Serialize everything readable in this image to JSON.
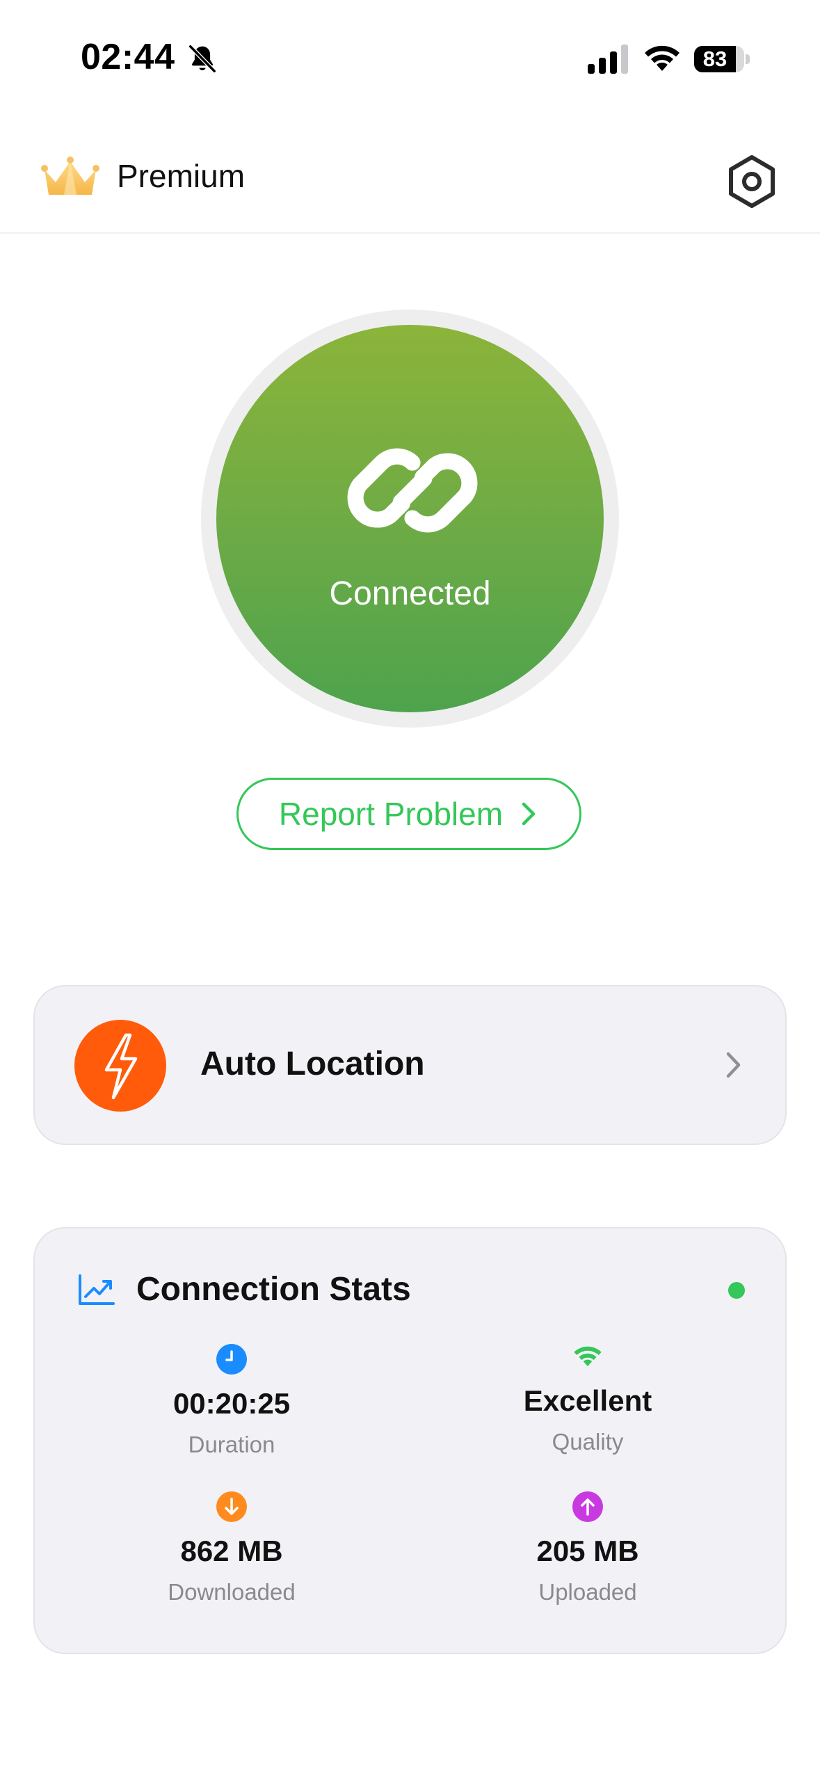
{
  "status_bar": {
    "time": "02:44",
    "battery": "83",
    "battery_level": 0.83,
    "icons": [
      "bell-slash-icon",
      "cellular-signal-icon",
      "wifi-icon",
      "battery-icon"
    ]
  },
  "header": {
    "title": "Premium",
    "icons": [
      "crown-icon",
      "settings-gear-icon"
    ]
  },
  "connection": {
    "status": "Connected",
    "icon": "link-icon",
    "report_label": "Report Problem"
  },
  "location": {
    "label": "Auto Location",
    "icon": "lightning-bolt-icon"
  },
  "stats": {
    "title": "Connection Stats",
    "items": [
      {
        "value": "00:20:25",
        "label": "Duration",
        "icon": "clock-icon",
        "color": "#1a8cff"
      },
      {
        "value": "Excellent",
        "label": "Quality",
        "icon": "wifi-quality-icon",
        "color": "#34c759"
      },
      {
        "value": "862 MB",
        "label": "Downloaded",
        "icon": "download-arrow-icon",
        "color": "#ff8a1f"
      },
      {
        "value": "205 MB",
        "label": "Uploaded",
        "icon": "upload-arrow-icon",
        "color": "#c83ae0"
      }
    ]
  },
  "colors": {
    "accent_green": "#34c759",
    "connect_gradient_top": "#8bb43a",
    "connect_gradient_bottom": "#4ea34d",
    "location_orange": "#ff5b0a",
    "card_background": "#f2f2f6"
  }
}
